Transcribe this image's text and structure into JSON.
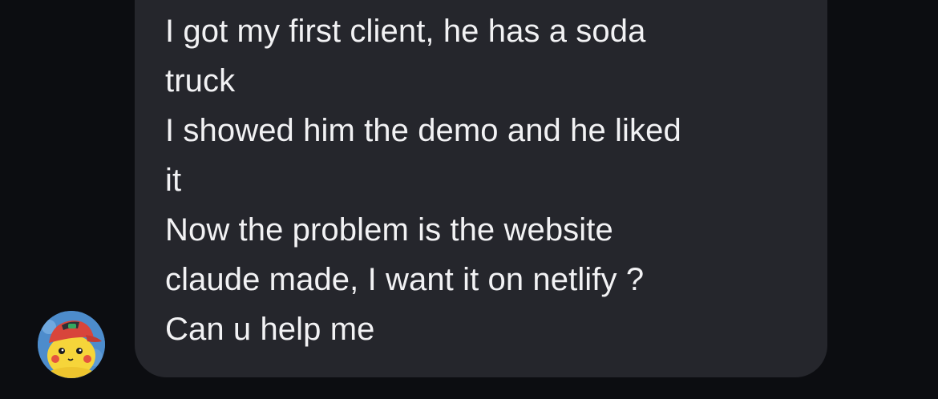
{
  "conversation": {
    "sender": {
      "avatar_icon": "pikachu-avatar-icon"
    },
    "message": {
      "lines": [
        "I got my first client, he has a soda",
        "truck",
        "I showed him the demo and he liked",
        "it",
        "Now the problem is the website",
        "claude made, I want it on netlify ?",
        "Can u help me"
      ]
    }
  },
  "colors": {
    "background": "#0c0d11",
    "bubble": "#25262c",
    "text": "#f2f2f4"
  }
}
